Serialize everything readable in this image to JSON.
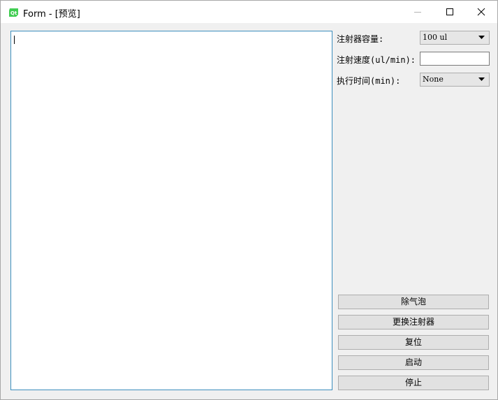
{
  "window": {
    "title": "Form - [预览]",
    "app_icon": "qt-designer-icon",
    "controls": [
      "minimize-icon",
      "maximize-icon",
      "close-icon"
    ]
  },
  "log_area": {
    "text": ""
  },
  "form": {
    "syringe_volume": {
      "label": "注射器容量:",
      "selected": "100 ul"
    },
    "injection_speed": {
      "label": "注射速度(ul/min):",
      "value": ""
    },
    "run_time": {
      "label": "执行时间(min):",
      "selected": "None"
    }
  },
  "buttons": {
    "remove_bubbles": "除气泡",
    "replace_syringe": "更换注射器",
    "reset": "复位",
    "start": "启动",
    "stop": "停止"
  },
  "colors": {
    "accent_border": "#3c8ebd",
    "app_icon_green": "#41cd52",
    "topline_red": "#d24b4b"
  }
}
